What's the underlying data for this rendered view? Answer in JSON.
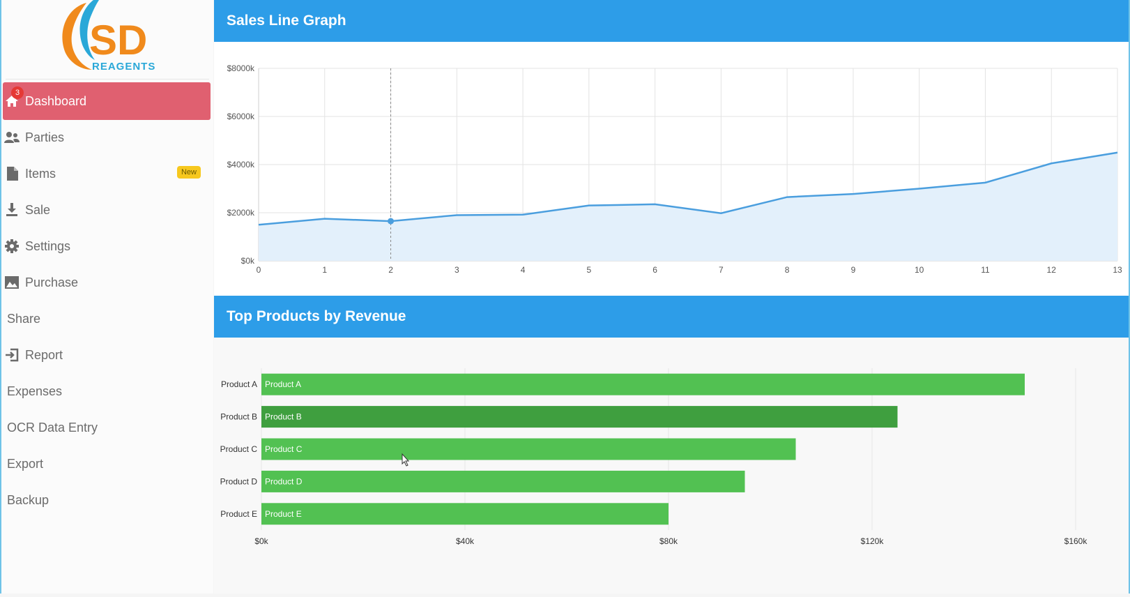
{
  "app": {
    "logo_text": "SD",
    "logo_subtext": "REAGENTS"
  },
  "sidebar": {
    "items": [
      {
        "label": "Dashboard",
        "icon": "home-icon",
        "active": true,
        "badge_count": "3"
      },
      {
        "label": "Parties",
        "icon": "users-icon"
      },
      {
        "label": "Items",
        "icon": "file-icon",
        "tag": "New"
      },
      {
        "label": "Sale",
        "icon": "download-icon"
      },
      {
        "label": "Settings",
        "icon": "gear-icon"
      },
      {
        "label": "Purchase",
        "icon": "image-icon"
      },
      {
        "label": "Share"
      },
      {
        "label": "Report",
        "icon": "sign-in-icon"
      },
      {
        "label": "Expenses"
      },
      {
        "label": "OCR Data Entry"
      },
      {
        "label": "Export"
      },
      {
        "label": "Backup"
      }
    ]
  },
  "colors": {
    "header_blue": "#2d9de8",
    "active_red": "#e06070",
    "bar_green": "#52c152",
    "bar_green_highlight": "#3f9f3f",
    "line_blue": "#4a9ede"
  },
  "chart_data": [
    {
      "type": "area",
      "title": "Sales Line Graph",
      "x": [
        0,
        1,
        2,
        3,
        4,
        5,
        6,
        7,
        8,
        9,
        10,
        11,
        12,
        13
      ],
      "values": [
        1500,
        1750,
        1650,
        1900,
        1920,
        2300,
        2350,
        1980,
        2650,
        2780,
        3000,
        3250,
        4050,
        4500
      ],
      "y_ticks": [
        "$0k",
        "$2000k",
        "$4000k",
        "$6000k",
        "$8000k"
      ],
      "ylim": [
        0,
        8000
      ],
      "highlight_x": 2,
      "grid": true
    },
    {
      "type": "bar",
      "orientation": "horizontal",
      "title": "Top Products by Revenue",
      "categories": [
        "Product A",
        "Product B",
        "Product C",
        "Product D",
        "Product E"
      ],
      "values": [
        150000,
        125000,
        105000,
        95000,
        80000
      ],
      "x_ticks": [
        "$0k",
        "$40k",
        "$80k",
        "$120k",
        "$160k"
      ],
      "xlim": [
        0,
        160000
      ],
      "highlight_index": 1,
      "grid": true
    }
  ]
}
